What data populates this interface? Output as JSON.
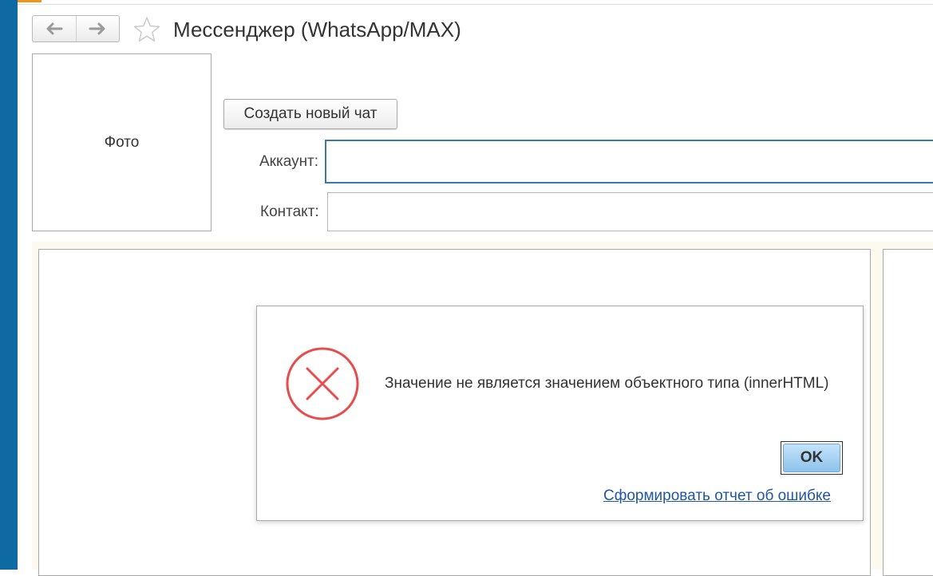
{
  "window": {
    "title": "Мессенджер (WhatsApp/MAX)",
    "back_icon": "arrow-left-icon",
    "forward_icon": "arrow-right-icon",
    "favorite_icon": "star-outline-icon"
  },
  "form": {
    "photo_label": "Фото",
    "new_chat_button": "Создать новый чат",
    "account_label": "Аккаунт:",
    "account_value": "",
    "contact_label": "Контакт:",
    "contact_value": ""
  },
  "dialog": {
    "icon": "error-x-icon",
    "message": "Значение не является значением объектного типа (innerHTML)",
    "ok_button": "OK",
    "report_link": "Сформировать отчет об ошибке"
  },
  "colors": {
    "left_bar": "#0f6aa3",
    "error_red": "#e84c4c",
    "link_blue": "#1f56a8",
    "ok_button_blue": "#a9d3f4",
    "panel_background": "#fcf9ef"
  }
}
